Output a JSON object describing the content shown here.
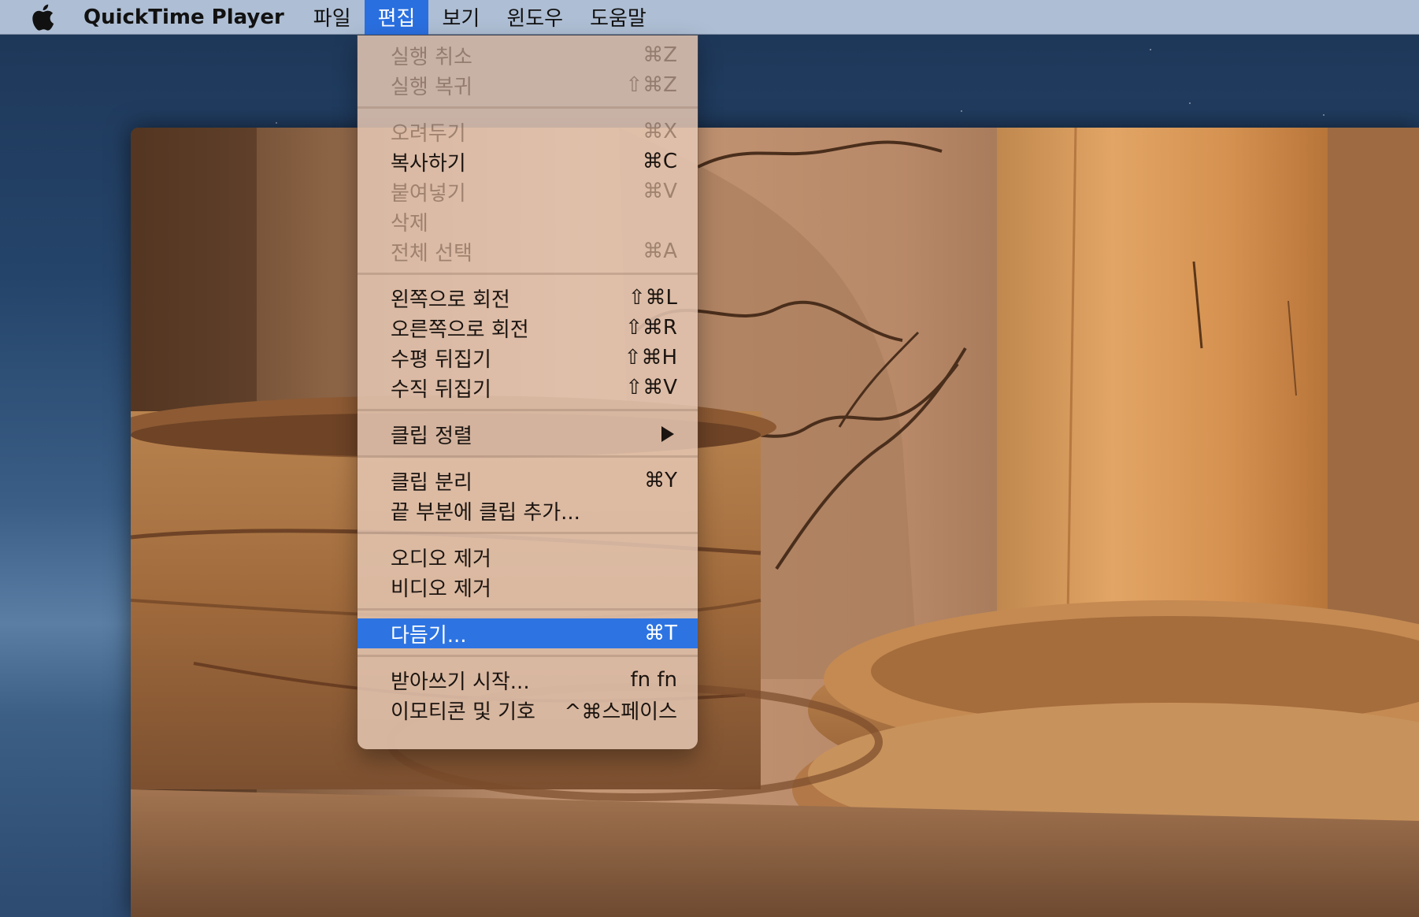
{
  "menubar": {
    "app_name": "QuickTime Player",
    "menus": [
      "파일",
      "편집",
      "보기",
      "윈도우",
      "도움말"
    ],
    "active_menu": "편집"
  },
  "edit_menu": {
    "groups": [
      [
        {
          "label": "실행 취소",
          "shortcut": "⌘Z",
          "enabled": false
        },
        {
          "label": "실행 복귀",
          "shortcut": "⇧⌘Z",
          "enabled": false
        }
      ],
      [
        {
          "label": "오려두기",
          "shortcut": "⌘X",
          "enabled": false
        },
        {
          "label": "복사하기",
          "shortcut": "⌘C",
          "enabled": true
        },
        {
          "label": "붙여넣기",
          "shortcut": "⌘V",
          "enabled": false
        },
        {
          "label": "삭제",
          "shortcut": "",
          "enabled": false
        },
        {
          "label": "전체 선택",
          "shortcut": "⌘A",
          "enabled": false
        }
      ],
      [
        {
          "label": "왼쪽으로 회전",
          "shortcut": "⇧⌘L",
          "enabled": true
        },
        {
          "label": "오른쪽으로 회전",
          "shortcut": "⇧⌘R",
          "enabled": true
        },
        {
          "label": "수평 뒤집기",
          "shortcut": "⇧⌘H",
          "enabled": true
        },
        {
          "label": "수직 뒤집기",
          "shortcut": "⇧⌘V",
          "enabled": true
        }
      ],
      [
        {
          "label": "클립 정렬",
          "shortcut": "",
          "enabled": true,
          "submenu": true
        }
      ],
      [
        {
          "label": "클립 분리",
          "shortcut": "⌘Y",
          "enabled": true
        },
        {
          "label": "끝 부분에 클립 추가...",
          "shortcut": "",
          "enabled": true
        }
      ],
      [
        {
          "label": "오디오 제거",
          "shortcut": "",
          "enabled": true
        },
        {
          "label": "비디오 제거",
          "shortcut": "",
          "enabled": true
        }
      ],
      [
        {
          "label": "다듬기...",
          "shortcut": "⌘T",
          "enabled": true,
          "highlighted": true
        }
      ],
      [
        {
          "label": "받아쓰기 시작...",
          "shortcut": "fn fn",
          "enabled": true
        },
        {
          "label": "이모티콘 및 기호",
          "shortcut": "^⌘스페이스",
          "enabled": true
        }
      ]
    ]
  },
  "colors": {
    "menubar_bg": "#b9c8de",
    "highlight": "#2d74e2",
    "menu_bg": "#e4c6b2"
  },
  "icons": {
    "apple": "apple-logo-icon",
    "submenu": "chevron-right-icon"
  }
}
